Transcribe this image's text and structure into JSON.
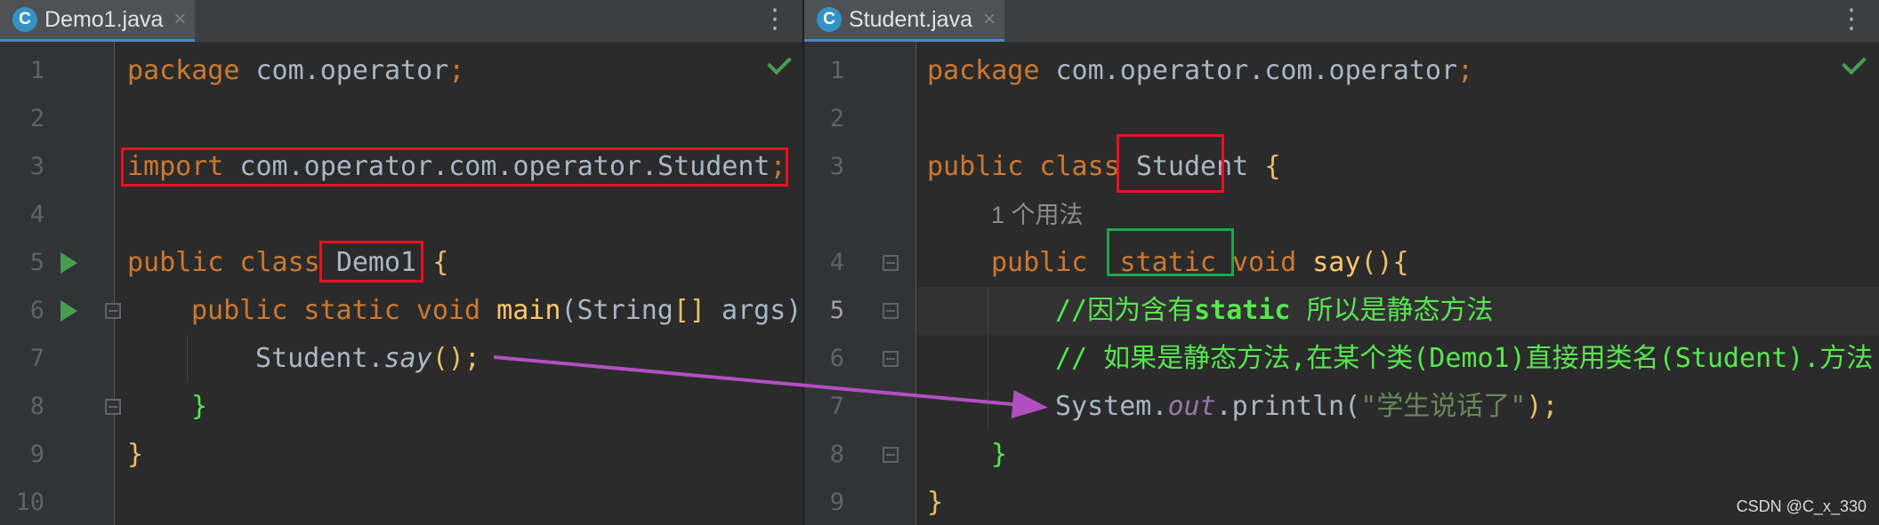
{
  "left": {
    "tab": {
      "icon_letter": "C",
      "title": "Demo1.java",
      "close": "×",
      "menu": "⋮"
    },
    "line_numbers": [
      "1",
      "2",
      "3",
      "4",
      "5",
      "6",
      "7",
      "8",
      "9",
      "10"
    ],
    "code": {
      "l1": {
        "kw": "package",
        "rest": " com.operator",
        "semi": ";"
      },
      "l3": {
        "kw": "import",
        "rest": " com.operator.com.operator.Student",
        "semi": ";"
      },
      "l5": {
        "kw": "public class",
        "name": "Demo1",
        "brace": "{"
      },
      "l6": {
        "kw": "public static void",
        "fn": "main",
        "params": "(String",
        "bracket": "[]",
        "rest": " args)"
      },
      "l7": {
        "obj": "Student.",
        "method": "say",
        "rest": "();"
      },
      "l8": {
        "brace": "}"
      },
      "l9": {
        "brace": "}"
      }
    }
  },
  "right": {
    "tab": {
      "icon_letter": "C",
      "title": "Student.java",
      "close": "×",
      "menu": "⋮"
    },
    "line_numbers": [
      "1",
      "2",
      "3",
      "4",
      "5",
      "6",
      "7",
      "8",
      "9"
    ],
    "inlay_hint": "1 个用法",
    "code": {
      "l1": {
        "kw": "package",
        "rest": " com.operator.com.operator",
        "semi": ";"
      },
      "l3": {
        "kw": "public class",
        "name": "Student",
        "brace": "{"
      },
      "l4": {
        "kw1": "public",
        "kw2": "static",
        "kw3": "void",
        "fn": "say",
        "rest": "(){"
      },
      "l5": {
        "c1": "//因为含有",
        "c2": "static",
        "c3": " 所以是静态方法"
      },
      "l6": {
        "comment": "// 如果是静态方法,在某个类(Demo1)直接用类名(Student).方法"
      },
      "l7": {
        "obj": "System.",
        "field": "out",
        "call": ".println(",
        "str": "\"学生说话了\"",
        "end": ");"
      },
      "l8": {
        "brace": "}"
      },
      "l9": {
        "brace": "}"
      }
    }
  },
  "watermark": "CSDN @C_x_330",
  "colors": {
    "background": "#2b2b2b",
    "keyword": "#cc7832",
    "function": "#ffc66d",
    "comment": "#57e650",
    "string": "#6a8759",
    "highlight_red": "#e81123",
    "highlight_green": "#1fa64a",
    "arrow": "#b04fc0"
  }
}
